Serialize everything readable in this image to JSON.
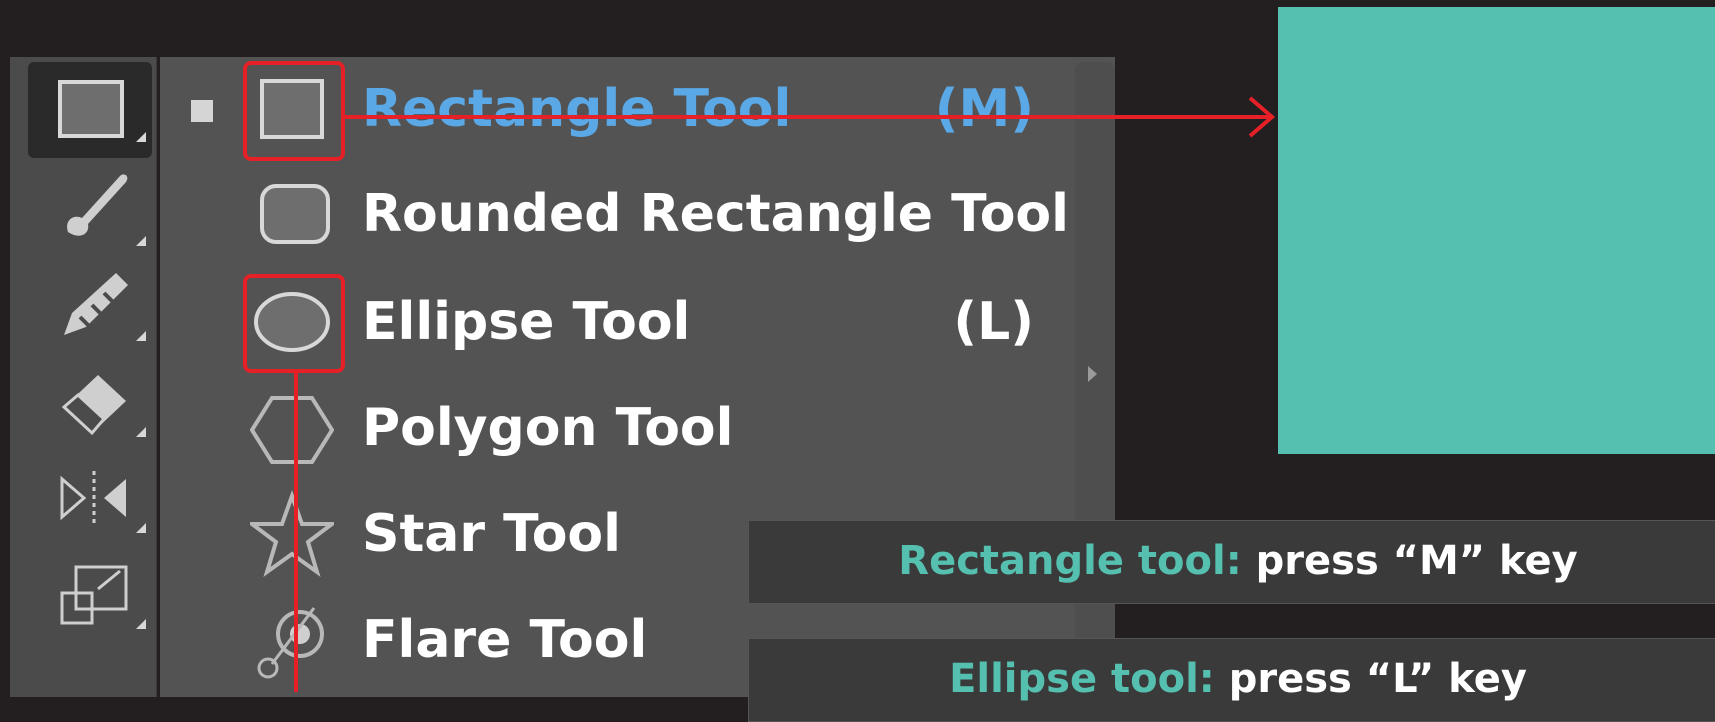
{
  "toolbar": {
    "tools": [
      {
        "icon": "rectangle-icon",
        "active": true
      },
      {
        "icon": "paintbrush-icon",
        "active": false
      },
      {
        "icon": "blob-brush-icon",
        "active": false
      },
      {
        "icon": "eraser-icon",
        "active": false
      },
      {
        "icon": "reflect-icon",
        "active": false
      },
      {
        "icon": "scale-icon",
        "active": false
      }
    ]
  },
  "flyout": {
    "items": [
      {
        "icon": "rectangle-icon",
        "label": "Rectangle Tool",
        "shortcut": "(M)",
        "selected": true
      },
      {
        "icon": "rounded-rectangle-icon",
        "label": "Rounded Rectangle Tool",
        "shortcut": "",
        "selected": false
      },
      {
        "icon": "ellipse-icon",
        "label": "Ellipse Tool",
        "shortcut": "(L)",
        "selected": false
      },
      {
        "icon": "polygon-icon",
        "label": "Polygon Tool",
        "shortcut": "",
        "selected": false
      },
      {
        "icon": "star-icon",
        "label": "Star Tool",
        "shortcut": "",
        "selected": false
      },
      {
        "icon": "flare-icon",
        "label": "Flare Tool",
        "shortcut": "",
        "selected": false
      }
    ]
  },
  "tips": [
    {
      "key": "Rectangle tool:",
      "value": "press “M” key"
    },
    {
      "key": "Ellipse tool:",
      "value": "press “L” key"
    }
  ],
  "colors": {
    "background": "#231f20",
    "annotation": "#e52027",
    "accent": "#56c0b0",
    "selected_text": "#5aa8e6"
  }
}
